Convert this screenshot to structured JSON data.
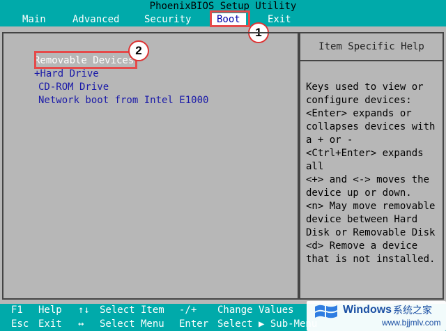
{
  "app": {
    "title": "PhoenixBIOS Setup Utility"
  },
  "menu": [
    "Main",
    "Advanced",
    "Security",
    "Boot",
    "Exit"
  ],
  "active_menu": "Boot",
  "boot": {
    "items": [
      {
        "prefix": "",
        "label": "Removable Devices"
      },
      {
        "prefix": "+",
        "label": "Hard Drive"
      },
      {
        "prefix": "",
        "label": "CD-ROM Drive"
      },
      {
        "prefix": "",
        "label": "Network boot from Intel E1000"
      }
    ]
  },
  "help": {
    "header": "Item Specific Help",
    "text": "Keys used to view or\nconfigure devices:\n<Enter> expands or\ncollapses devices with\na + or -\n<Ctrl+Enter> expands\nall\n<+> and <-> moves the\ndevice up or down.\n<n> May move removable\ndevice between Hard\nDisk or Removable Disk\n<d> Remove a device\nthat is not installed."
  },
  "keys": {
    "row1": [
      {
        "key": "F1",
        "desc": "Help"
      },
      {
        "key": "↑↓",
        "desc": "Select Item"
      },
      {
        "key": "-/+",
        "desc": "Change Values"
      }
    ],
    "row2": [
      {
        "key": "Esc",
        "desc": "Exit"
      },
      {
        "key": "↔",
        "desc": "Select Menu"
      },
      {
        "key": "Enter",
        "desc": "Select ▶ Sub-Menu"
      }
    ]
  },
  "annotations": {
    "step1": "1",
    "step2": "2"
  },
  "watermark": {
    "brand": "Windows",
    "cn": "系统之家",
    "url": "www.bjjmlv.com"
  },
  "colors": {
    "title_bar": "#00aaaa",
    "background": "#b7b7b7",
    "item_text": "#1a1aa8",
    "selected_text": "#ffffff",
    "highlight": "#e54a4a"
  }
}
